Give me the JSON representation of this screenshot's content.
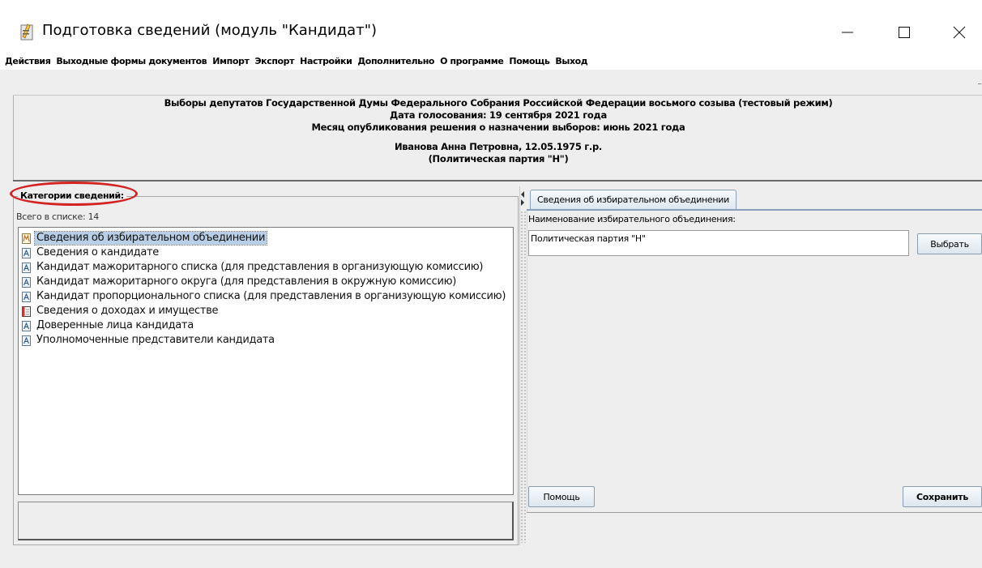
{
  "window": {
    "title": "Подготовка сведений (модуль \"Кандидат\")",
    "icon": "app-icon",
    "controls": [
      "minimize-icon",
      "maximize-icon",
      "close-icon"
    ]
  },
  "menubar": {
    "items": [
      "Действия",
      "Выходные формы документов",
      "Импорт",
      "Экспорт",
      "Настройки",
      "Дополнительно",
      "О программе",
      "Помощь",
      "Выход"
    ]
  },
  "header": {
    "line1": "Выборы депутатов Государственной Думы Федерального Собрания Российской Федерации восьмого созыва (тестовый режим)",
    "line2": "Дата голосования: 19 сентября 2021 года",
    "line3": "Месяц опубликования решения о назначении выборов: июнь 2021 года",
    "line4": "Иванова Анна Петровна, 12.05.1975 г.р.",
    "line5": "(Политическая партия \"Н\")"
  },
  "left_panel": {
    "group_title": "Категории сведений:",
    "count_text": "Всего в списке: 14",
    "items": [
      {
        "label": "Сведения об избирательном объединении",
        "icon": "document-edit-icon",
        "selected": true
      },
      {
        "label": "Сведения о кандидате",
        "icon": "document-icon",
        "selected": false
      },
      {
        "label": "Кандидат мажоритарного списка (для представления в организующую комиссию)",
        "icon": "document-icon",
        "selected": false
      },
      {
        "label": "Кандидат мажоритарного округа (для представления в окружную комиссию)",
        "icon": "document-icon",
        "selected": false
      },
      {
        "label": "Кандидат пропорционального списка (для представления в организующую комиссию)",
        "icon": "document-icon",
        "selected": false
      },
      {
        "label": "Сведения о доходах и имуществе",
        "icon": "document-red-icon",
        "selected": false
      },
      {
        "label": "Доверенные лица кандидата",
        "icon": "document-icon",
        "selected": false
      },
      {
        "label": "Уполномоченные представители кандидата",
        "icon": "document-icon",
        "selected": false
      }
    ]
  },
  "right_panel": {
    "tab_label": "Сведения об избирательном объединении",
    "field_label": "Наименование избирательного объединения:",
    "field_value": "Политическая партия \"Н\"",
    "select_button": "Выбрать",
    "help_button": "Помощь",
    "save_button": "Сохранить"
  },
  "colors": {
    "highlight_ellipse": "#d42323",
    "selection": "#b8cfe5",
    "tab_border": "#8aa0b8"
  }
}
